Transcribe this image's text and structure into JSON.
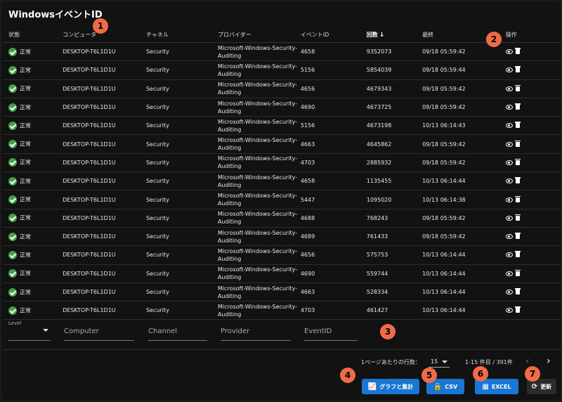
{
  "title": "WindowsイベントID",
  "columns": {
    "status": "状態",
    "computer": "コンピュータ",
    "channel": "チャネル",
    "provider": "プロバイダー",
    "event_id": "イベントID",
    "count": "回数",
    "last": "最終",
    "ops": "操作"
  },
  "sort_arrow": "↓",
  "rows": [
    {
      "status": "正常",
      "computer": "DESKTOP-T6L1D1U",
      "channel": "Security",
      "provider": "Microsoft-Windows-Security-Auditing",
      "event_id": "4658",
      "count": "9352073",
      "last": "09/18 05:59:42"
    },
    {
      "status": "正常",
      "computer": "DESKTOP-T6L1D1U",
      "channel": "Security",
      "provider": "Microsoft-Windows-Security-Auditing",
      "event_id": "5156",
      "count": "5854039",
      "last": "09/18 05:59:44"
    },
    {
      "status": "正常",
      "computer": "DESKTOP-T6L1D1U",
      "channel": "Security",
      "provider": "Microsoft-Windows-Security-Auditing",
      "event_id": "4656",
      "count": "4679343",
      "last": "09/18 05:59:42"
    },
    {
      "status": "正常",
      "computer": "DESKTOP-T6L1D1U",
      "channel": "Security",
      "provider": "Microsoft-Windows-Security-Auditing",
      "event_id": "4690",
      "count": "4673725",
      "last": "09/18 05:59:42"
    },
    {
      "status": "正常",
      "computer": "DESKTOP-T6L1D1U",
      "channel": "Security",
      "provider": "Microsoft-Windows-Security-Auditing",
      "event_id": "5156",
      "count": "4673198",
      "last": "10/13 06:14:43"
    },
    {
      "status": "正常",
      "computer": "DESKTOP-T6L1D1U",
      "channel": "Security",
      "provider": "Microsoft-Windows-Security-Auditing",
      "event_id": "4663",
      "count": "4645862",
      "last": "09/18 05:59:42"
    },
    {
      "status": "正常",
      "computer": "DESKTOP-T6L1D1U",
      "channel": "Security",
      "provider": "Microsoft-Windows-Security-Auditing",
      "event_id": "4703",
      "count": "2885932",
      "last": "09/18 05:59:42"
    },
    {
      "status": "正常",
      "computer": "DESKTOP-T6L1D1U",
      "channel": "Security",
      "provider": "Microsoft-Windows-Security-Auditing",
      "event_id": "4658",
      "count": "1135455",
      "last": "10/13 06:14:44"
    },
    {
      "status": "正常",
      "computer": "DESKTOP-T6L1D1U",
      "channel": "Security",
      "provider": "Microsoft-Windows-Security-Auditing",
      "event_id": "5447",
      "count": "1095020",
      "last": "10/13 06:14:38"
    },
    {
      "status": "正常",
      "computer": "DESKTOP-T6L1D1U",
      "channel": "Security",
      "provider": "Microsoft-Windows-Security-Auditing",
      "event_id": "4688",
      "count": "768243",
      "last": "09/18 05:59:42"
    },
    {
      "status": "正常",
      "computer": "DESKTOP-T6L1D1U",
      "channel": "Security",
      "provider": "Microsoft-Windows-Security-Auditing",
      "event_id": "4689",
      "count": "761433",
      "last": "09/18 05:59:42"
    },
    {
      "status": "正常",
      "computer": "DESKTOP-T6L1D1U",
      "channel": "Security",
      "provider": "Microsoft-Windows-Security-Auditing",
      "event_id": "4656",
      "count": "575753",
      "last": "10/13 06:14:44"
    },
    {
      "status": "正常",
      "computer": "DESKTOP-T6L1D1U",
      "channel": "Security",
      "provider": "Microsoft-Windows-Security-Auditing",
      "event_id": "4690",
      "count": "559744",
      "last": "10/13 06:14:44"
    },
    {
      "status": "正常",
      "computer": "DESKTOP-T6L1D1U",
      "channel": "Security",
      "provider": "Microsoft-Windows-Security-Auditing",
      "event_id": "4663",
      "count": "528334",
      "last": "10/13 06:14:44"
    },
    {
      "status": "正常",
      "computer": "DESKTOP-T6L1D1U",
      "channel": "Security",
      "provider": "Microsoft-Windows-Security-Auditing",
      "event_id": "4703",
      "count": "461427",
      "last": "10/13 06:14:44"
    }
  ],
  "filters": {
    "level_label": "Level",
    "computer_placeholder": "Computer",
    "channel_placeholder": "Channel",
    "provider_placeholder": "Provider",
    "eventid_placeholder": "EventID"
  },
  "pagination": {
    "rows_per_page_label": "1ページあたりの行数：",
    "rows_per_page_value": "15",
    "range_text": "1-15 件目 / 391件",
    "prev": "‹",
    "next": "›"
  },
  "buttons": {
    "chart": "グラフと集計",
    "csv": "CSV",
    "excel": "EXCEL",
    "refresh": "更新"
  },
  "badges": [
    "1",
    "2",
    "3",
    "4",
    "5",
    "6",
    "7"
  ],
  "colors": {
    "background": "#121212",
    "status_ok": "#43a047",
    "primary_button": "#1976d2",
    "badge": "#ef6c47"
  }
}
